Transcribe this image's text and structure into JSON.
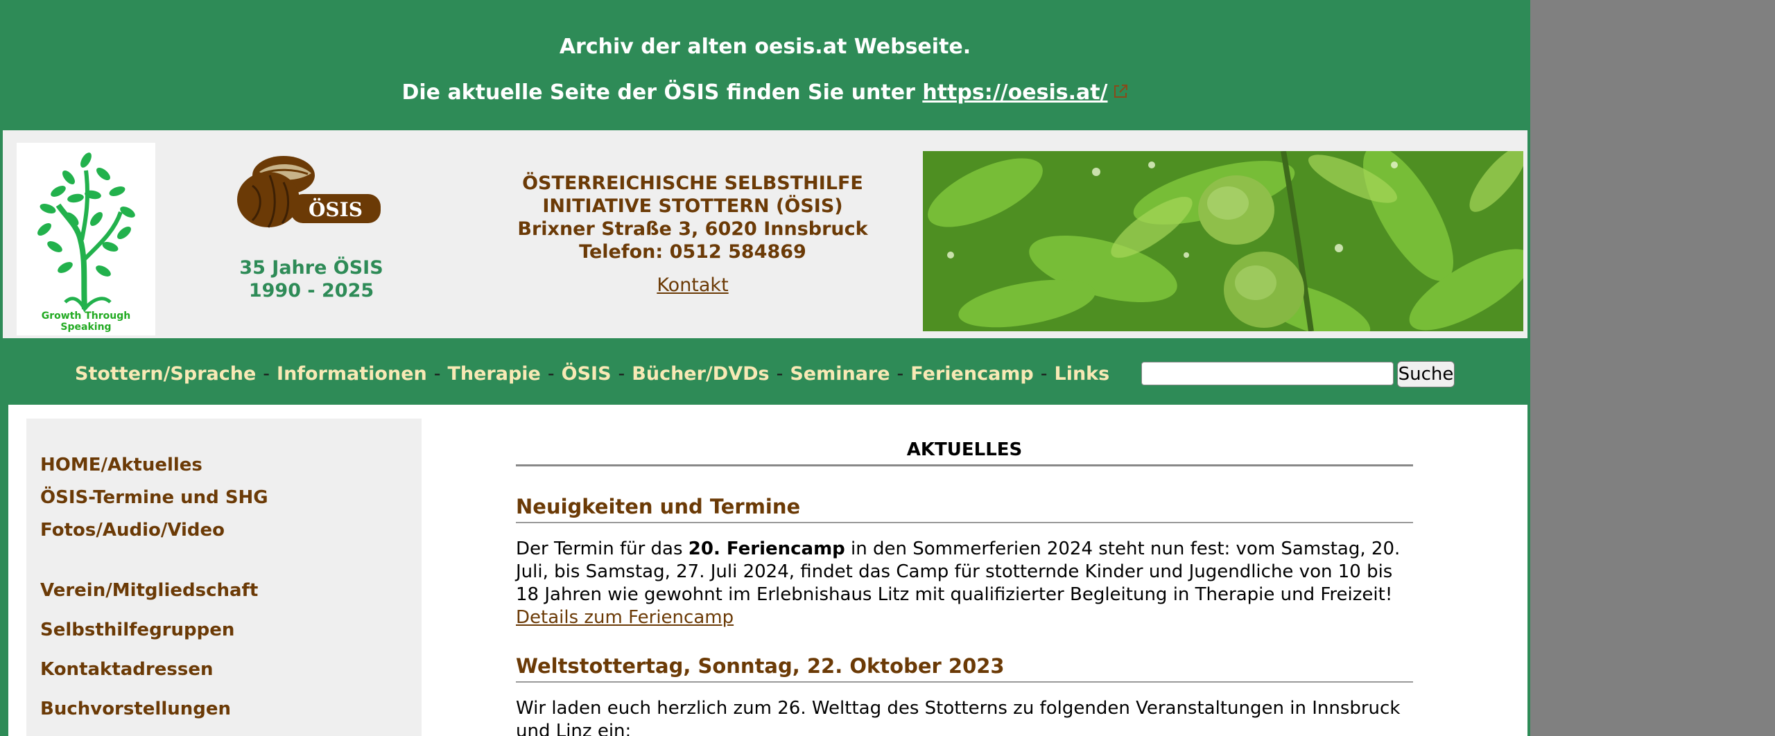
{
  "banner": {
    "line1": "Archiv der alten oesis.at Webseite.",
    "line2_text": "Die aktuelle Seite der ÖSIS finden Sie unter ",
    "line2_link": "https://oesis.at/",
    "external_icon": "external-link-icon"
  },
  "header": {
    "tree_caption": "Growth Through Speaking",
    "osis_logo_text": "ÖSIS",
    "anniversary_line1": "35 Jahre ÖSIS",
    "anniversary_line2": "1990 - 2025",
    "address_line1": "ÖSTERREICHISCHE SELBSTHILFE",
    "address_line2": "INITIATIVE STOTTERN (ÖSIS)",
    "address_line3": "Brixner Straße 3, 6020 Innsbruck",
    "address_line4": "Telefon: 0512 584869",
    "contact_link": "Kontakt"
  },
  "nav": {
    "items": [
      "Stottern/Sprache",
      "Informationen",
      "Therapie",
      "ÖSIS",
      "Bücher/DVDs",
      "Seminare",
      "Feriencamp",
      "Links"
    ],
    "separator": "-",
    "search_value": "",
    "search_button": "Suche"
  },
  "sidebar": {
    "items": [
      "HOME/Aktuelles",
      "ÖSIS-Termine und SHG",
      "Fotos/Audio/Video",
      "Verein/Mitgliedschaft",
      "Selbsthilfegruppen",
      "Kontaktadressen",
      "Buchvorstellungen"
    ]
  },
  "main": {
    "section_title": "AKTUELLES",
    "news_heading": "Neuigkeiten und Termine",
    "news_p_before": "Der Termin für das ",
    "news_p_bold": "20. Feriencamp",
    "news_p_after": " in den Sommerferien 2024 steht nun fest: vom Samstag, 20. Juli, bis Samstag, 27. Juli 2024, findet das Camp für stotternde Kinder und Jugendliche von 10 bis 18 Jahren wie gewohnt im Erlebnishaus Litz mit qualifizierter Begleitung in Therapie und Freizeit!",
    "news_link": "Details zum Feriencamp",
    "wst_heading": "Weltstottertag, Sonntag, 22. Oktober 2023",
    "wst_p": "Wir laden euch herzlich zum 26. Welttag des Stotterns zu folgenden Veranstaltungen in Innsbruck und Linz ein:"
  },
  "colors": {
    "green": "#2e8b57",
    "brown": "#6b3a06",
    "nav_text": "#f8e9b5",
    "panel": "#efefef"
  }
}
